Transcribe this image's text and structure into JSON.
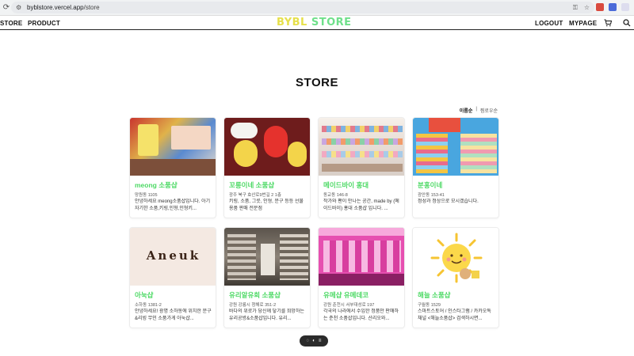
{
  "browser": {
    "url_host": "byblstore.vercel.app",
    "url_path": "/store"
  },
  "nav": {
    "left_items": [
      "STORE",
      "PRODUCT"
    ],
    "logo_part1": "BYBL",
    "logo_part2": "STORE",
    "logout": "LOGOUT",
    "mypage": "MYPAGE"
  },
  "page": {
    "title": "STORE",
    "sort_popular": "이름순",
    "sort_separator": "|",
    "sort_recent": "찜로우순"
  },
  "stores": [
    {
      "name": "meong 소품샵",
      "address": "망원동 1105",
      "description": "안녕하세요 meong소품샵입니다. 아기자기한 소품,키링,인형,인형키..."
    },
    {
      "name": "꼬롱이네 소품샵",
      "address": "광주 북구 효산로9번길 2 1층",
      "description": "키링, 소품, 그릇, 인형, 문구 등등 선물 용품 판매 전문점"
    },
    {
      "name": "메이드바이 홍대",
      "address": "동교동 146-8",
      "description": "작가와 팬이 만나는 공간, made by (메이드바이) 홍대 소품샵 입니다. ..."
    },
    {
      "name": "분홍이네",
      "address": "광안동 153-41",
      "description": "정성과 정상으로 모시겠습니다."
    },
    {
      "name": "아눅샵",
      "address": "소하동 1381-2",
      "description": "안녕하세요! 광명 소하동에 위치한 문구&리빙 무인 소품가게 아눅샵...",
      "image_text": "Aneuk"
    },
    {
      "name": "유리알유희 소품샵",
      "address": "강원 강릉시 청해로 351-2",
      "description": "바다의 위로가 당신께 닿기를 희망하는 유리공방&소품샵입니다. 유리..."
    },
    {
      "name": "유메샵 유메데코",
      "address": "강원 춘천시 서부대성로 197",
      "description": "각국의 나라에서 수입한 정품만 판매하는 춘천 소품샵입니다. 산리오와..."
    },
    {
      "name": "해늘 소품샵",
      "address": "구월동 1529",
      "description": "스마트스토어 / 인스타그램 / 카카오톡 채널 <해늘소품샵> 검색하시면..."
    }
  ],
  "colors": {
    "accent_green": "#4cd964",
    "logo_yellow": "#e6e04a",
    "logo_green": "#6fe08a"
  }
}
